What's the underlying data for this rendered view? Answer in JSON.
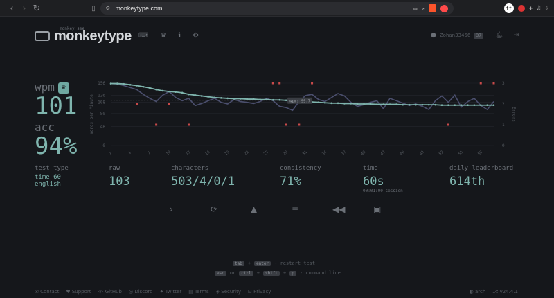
{
  "browser": {
    "url": "monkeytype.com",
    "extension_initial": "ff"
  },
  "header": {
    "logo_sub": "monkey see",
    "logo": "monkeytype",
    "username": "Zohan33456",
    "level": "37"
  },
  "result": {
    "wpm_label": "wpm",
    "wpm": "101",
    "acc_label": "acc",
    "acc": "94%",
    "test_type_label": "test type",
    "test_type_mode": "time 60",
    "test_type_lang": "english",
    "raw_label": "raw",
    "raw": "103",
    "characters_label": "characters",
    "characters": "503/4/0/1",
    "consistency_label": "consistency",
    "consistency": "71%",
    "time_label": "time",
    "time": "60s",
    "session": "00:01:00 session",
    "leaderboard_label": "daily leaderboard",
    "leaderboard": "614th"
  },
  "hints": {
    "line1": {
      "k1": "tab",
      "plus": "+",
      "k2": "enter",
      "text": "- restart test"
    },
    "line2": {
      "k1": "esc",
      "or": "or",
      "k2": "ctrl",
      "plus": "+",
      "k3": "shift",
      "plus2": "+",
      "k4": "p",
      "text": "- command line"
    }
  },
  "footer": {
    "left": [
      "Contact",
      "Support",
      "GitHub",
      "Discord",
      "Twitter",
      "Terms",
      "Security",
      "Privacy"
    ],
    "theme": "arch",
    "version": "v24.4.1"
  },
  "chart_data": {
    "type": "line",
    "ylabel": "Words per Minute",
    "y2label": "Errors",
    "y_ticks": [
      0,
      48,
      80,
      108,
      126,
      156
    ],
    "y2_ticks": [
      0,
      1,
      2,
      3
    ],
    "x": [
      1,
      2,
      3,
      4,
      5,
      6,
      7,
      8,
      9,
      10,
      11,
      12,
      13,
      14,
      15,
      16,
      17,
      18,
      19,
      20,
      21,
      22,
      23,
      24,
      25,
      26,
      27,
      28,
      29,
      30,
      31,
      32,
      33,
      34,
      35,
      36,
      37,
      38,
      39,
      40,
      41,
      42,
      43,
      44,
      45,
      46,
      47,
      48,
      49,
      50,
      51,
      52,
      53,
      54,
      55,
      56,
      57,
      58,
      59,
      60
    ],
    "x_tick_labels": [
      "1",
      "4",
      "7",
      "10",
      "13",
      "16",
      "19",
      "22",
      "25",
      "28",
      "31",
      "34",
      "37",
      "40",
      "43",
      "46",
      "49",
      "52",
      "55",
      "58"
    ],
    "tooltip": "wpm: 99.7",
    "series": [
      {
        "name": "wpm",
        "color": "#7fb5ae",
        "values": [
          155,
          155,
          154,
          152,
          150,
          147,
          144,
          140,
          137,
          135,
          134,
          132,
          128,
          126,
          124,
          122,
          120,
          119,
          118,
          117,
          117,
          116,
          116,
          115,
          115,
          114,
          114,
          113,
          112,
          111,
          110,
          109,
          108,
          107,
          106,
          106,
          105,
          105,
          104,
          104,
          104,
          103,
          103,
          103,
          103,
          102,
          102,
          102,
          102,
          102,
          102,
          101,
          101,
          101,
          101,
          101,
          101,
          101,
          101,
          101
        ]
      },
      {
        "name": "raw",
        "color": "#4b4f6e",
        "values": [
          155,
          154,
          150,
          145,
          140,
          128,
          118,
          110,
          126,
          135,
          120,
          112,
          118,
          100,
          105,
          112,
          118,
          108,
          104,
          115,
          110,
          108,
          105,
          110,
          118,
          112,
          98,
          95,
          88,
          110,
          125,
          128,
          115,
          110,
          120,
          130,
          124,
          108,
          98,
          102,
          108,
          112,
          92,
          118,
          112,
          106,
          100,
          104,
          98,
          90,
          112,
          124,
          108,
          126,
          96,
          110,
          118,
          100,
          90,
          110
        ]
      },
      {
        "name": "errors",
        "color": "#c94a4a",
        "values": [
          0,
          0,
          0,
          0,
          2,
          0,
          0,
          1,
          0,
          2,
          0,
          0,
          1,
          0,
          0,
          0,
          0,
          0,
          0,
          0,
          0,
          0,
          0,
          0,
          0,
          3,
          3,
          1,
          0,
          1,
          0,
          3,
          0,
          0,
          0,
          0,
          0,
          0,
          0,
          0,
          0,
          0,
          0,
          0,
          0,
          0,
          0,
          0,
          0,
          0,
          0,
          0,
          1,
          0,
          0,
          0,
          0,
          3,
          0,
          3
        ]
      }
    ]
  },
  "colors": {
    "bg": "#15171b",
    "main": "#7fb5ae",
    "sub": "#6b7077",
    "error": "#c94a4a"
  }
}
